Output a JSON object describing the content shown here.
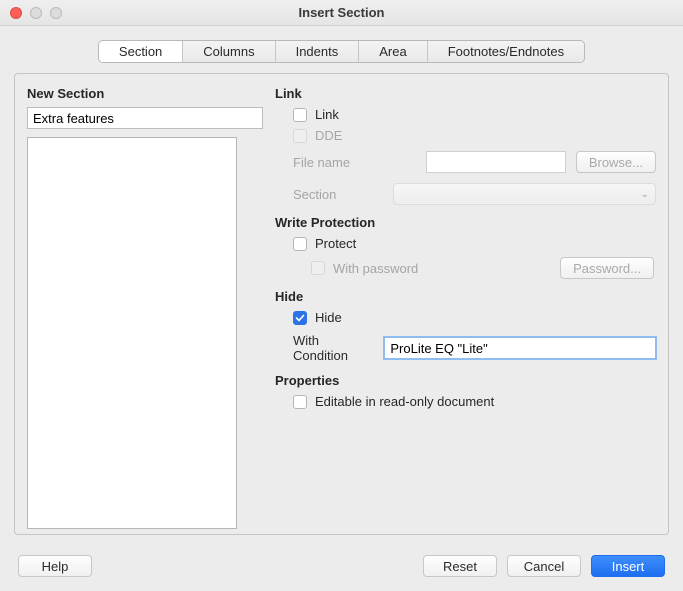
{
  "window": {
    "title": "Insert Section"
  },
  "tabs": [
    "Section",
    "Columns",
    "Indents",
    "Area",
    "Footnotes/Endnotes"
  ],
  "active_tab_index": 0,
  "left": {
    "heading": "New Section",
    "name_value": "Extra features"
  },
  "link": {
    "heading": "Link",
    "link_label": "Link",
    "link_checked": false,
    "dde_label": "DDE",
    "dde_enabled": false,
    "filename_label": "File name",
    "filename_value": "",
    "browse_label": "Browse...",
    "section_label": "Section",
    "section_value": ""
  },
  "write_protection": {
    "heading": "Write Protection",
    "protect_label": "Protect",
    "protect_checked": false,
    "with_password_label": "With password",
    "with_password_enabled": false,
    "password_btn": "Password..."
  },
  "hide": {
    "heading": "Hide",
    "hide_label": "Hide",
    "hide_checked": true,
    "condition_label": "With Condition",
    "condition_value": "ProLite EQ \"Lite\""
  },
  "properties": {
    "heading": "Properties",
    "editable_label": "Editable in read-only document",
    "editable_checked": false
  },
  "footer": {
    "help": "Help",
    "reset": "Reset",
    "cancel": "Cancel",
    "insert": "Insert"
  }
}
